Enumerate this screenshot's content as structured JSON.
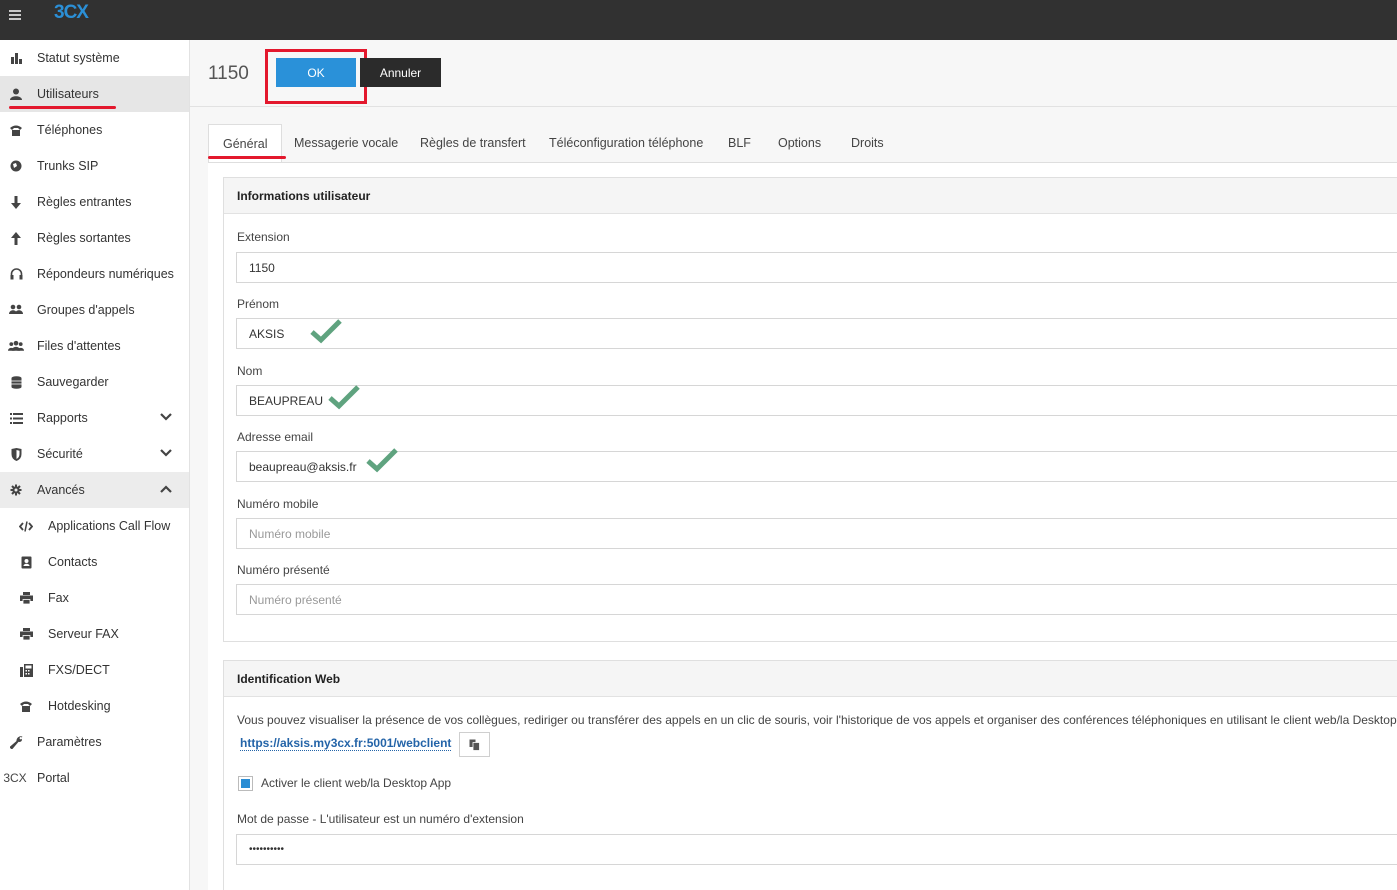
{
  "app": {
    "logo": "3CX"
  },
  "sidebar": {
    "items": [
      {
        "label": "Statut système",
        "icon": "bar-chart-icon"
      },
      {
        "label": "Utilisateurs",
        "icon": "user-icon"
      },
      {
        "label": "Téléphones",
        "icon": "phone-icon"
      },
      {
        "label": "Trunks SIP",
        "icon": "globe-icon"
      },
      {
        "label": "Règles entrantes",
        "icon": "arrow-down-icon"
      },
      {
        "label": "Règles sortantes",
        "icon": "arrow-up-icon"
      },
      {
        "label": "Répondeurs numériques",
        "icon": "headset-icon"
      },
      {
        "label": "Groupes d'appels",
        "icon": "group-icon"
      },
      {
        "label": "Files d'attentes",
        "icon": "users-icon"
      },
      {
        "label": "Sauvegarder",
        "icon": "database-icon"
      },
      {
        "label": "Rapports",
        "icon": "list-icon"
      },
      {
        "label": "Sécurité",
        "icon": "shield-icon"
      },
      {
        "label": "Avancés",
        "icon": "gear-icon"
      },
      {
        "label": "Applications Call Flow",
        "icon": "code-icon"
      },
      {
        "label": "Contacts",
        "icon": "contact-card-icon"
      },
      {
        "label": "Fax",
        "icon": "printer-icon"
      },
      {
        "label": "Serveur FAX",
        "icon": "printer-icon"
      },
      {
        "label": "FXS/DECT",
        "icon": "fax-machine-icon"
      },
      {
        "label": "Hotdesking",
        "icon": "phone-icon"
      },
      {
        "label": "Paramètres",
        "icon": "wrench-icon"
      },
      {
        "label": "Portal",
        "icon": "3cx-icon",
        "icon_text": "3CX"
      }
    ]
  },
  "header": {
    "extension_title": "1150",
    "ok_label": "OK",
    "cancel_label": "Annuler"
  },
  "tabs": [
    {
      "label": "Général"
    },
    {
      "label": "Messagerie vocale"
    },
    {
      "label": "Règles de transfert"
    },
    {
      "label": "Téléconfiguration téléphone"
    },
    {
      "label": "BLF"
    },
    {
      "label": "Options"
    },
    {
      "label": "Droits"
    }
  ],
  "user_info": {
    "title": "Informations utilisateur",
    "extension_label": "Extension",
    "extension_value": "1150",
    "firstname_label": "Prénom",
    "firstname_value": "AKSIS",
    "lastname_label": "Nom",
    "lastname_value": "BEAUPREAU",
    "email_label": "Adresse email",
    "email_value": "beaupreau@aksis.fr",
    "mobile_label": "Numéro mobile",
    "mobile_placeholder": "Numéro mobile",
    "presented_label": "Numéro présenté",
    "presented_placeholder": "Numéro présenté"
  },
  "web_id": {
    "title": "Identification Web",
    "description": "Vous pouvez visualiser la présence de vos collègues, rediriger ou transférer des appels en un clic de souris, voir l'historique de vos appels et organiser des conférences téléphoniques en utilisant le client web/la Desktop App.",
    "link": "https://aksis.my3cx.fr:5001/webclient",
    "enable_label": "Activer le client web/la Desktop App",
    "enable_checked": true,
    "password_label": "Mot de passe - L'utilisateur est un numéro d'extension",
    "password_value": "••••••••••"
  },
  "colors": {
    "accent": "#2a91d9",
    "highlight_red": "#e3182d",
    "check_green": "#5fa37f",
    "topbar": "#313131"
  }
}
